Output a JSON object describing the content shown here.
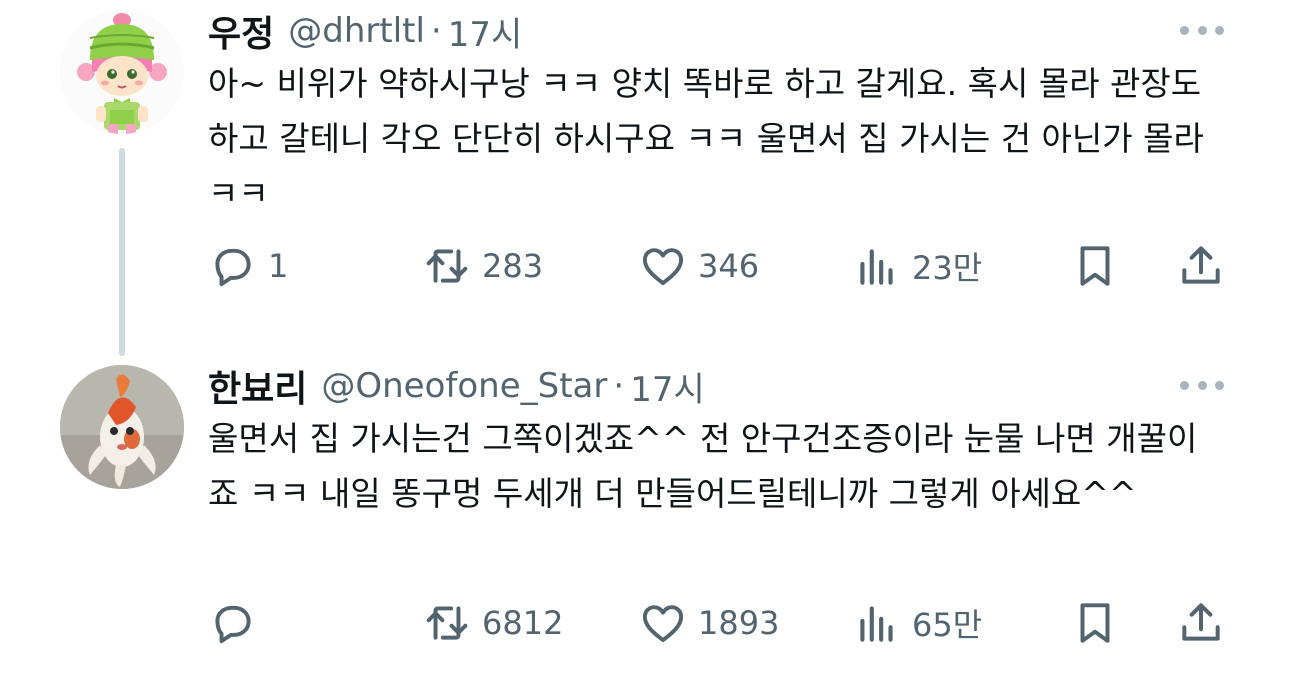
{
  "tweets": [
    {
      "display_name": "우정",
      "handle": "@dhrtltl",
      "separator": "·",
      "time": "17시",
      "text": "아~ 비위가 약하시구낭 ㅋㅋ 양치 똑바로 하고 갈게요. 혹시 몰라 관장도 하고 갈테니 각오 단단히 하시구요 ㅋㅋ 울면서 집 가시는 건 아닌가 몰라 ㅋㅋ",
      "avatar_icon": "green-hat-cartoon-girl-avatar",
      "metrics": {
        "replies": "1",
        "retweets": "283",
        "likes": "346",
        "views": "23만"
      }
    },
    {
      "display_name": "한뵤리",
      "handle": "@Oneofone_Star",
      "separator": "·",
      "time": "17시",
      "text": "울면서 집 가시는건 그쪽이겠죠^^ 전 안구건조증이라 눈물 나면 개꿀이죠 ㅋㅋ 내일 똥구멍 두세개 더 만들어드릴테니까 그렇게 아세요^^",
      "avatar_icon": "goldfish-photo-avatar",
      "metrics": {
        "replies": "",
        "retweets": "6812",
        "likes": "1893",
        "views": "65만"
      }
    }
  ],
  "colors": {
    "text": "#0f1419",
    "secondary": "#536471",
    "thread_line": "#cfd9de"
  }
}
